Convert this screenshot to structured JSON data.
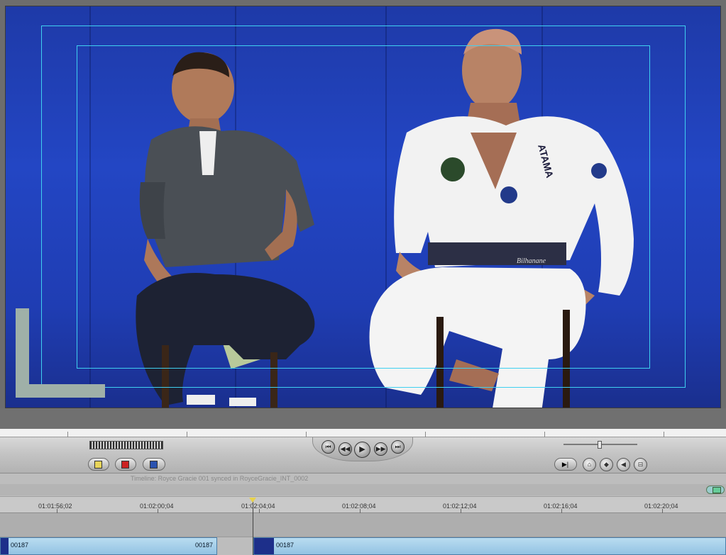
{
  "viewer": {
    "shirt_text": "ATAMA",
    "belt_text": "Bilhanane"
  },
  "timeline": {
    "title": "Timeline: Royce Gracie 001 synced in RoyceGracie_INT_0002",
    "ruler_timecodes": [
      "01:01:56;02",
      "01:02:00;04",
      "01:02:04;04",
      "01:02:08;04",
      "01:02:12;04",
      "01:02:16;04",
      "01:02:20;04"
    ],
    "clips": [
      {
        "left_label": "00187",
        "right_label": "00187"
      },
      {
        "left_label": "00187",
        "right_label": ""
      }
    ]
  },
  "transport": {
    "prev_edit": "⏮",
    "step_back": "◀◀",
    "play": "▶",
    "step_fwd": "▶▶",
    "next_edit": "⏭"
  },
  "colors": {
    "viewer_bg": "#2346c4",
    "safe_area": "#3fd0f0",
    "clip": "#93c3e3",
    "playhead": "#e8d24a"
  }
}
